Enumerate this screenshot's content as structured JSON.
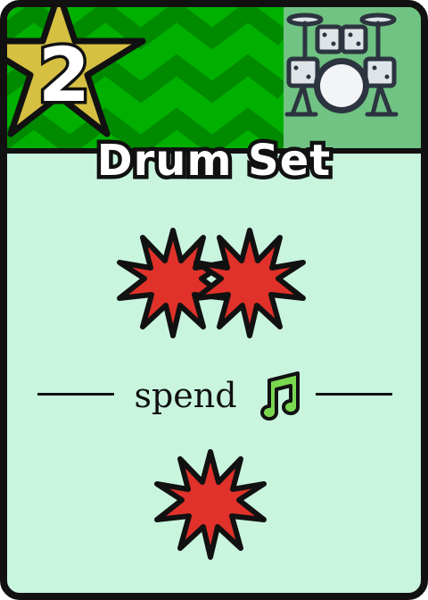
{
  "card": {
    "cost": "2",
    "title": "Drum Set",
    "spend_label": "spend",
    "art_icon": "drum-set-icon",
    "cost_icon": "star-icon",
    "resource_icon": "music-note-icon",
    "top_effect": {
      "icon": "burst-icon",
      "count": 2
    },
    "bottom_effect": {
      "icon": "burst-icon",
      "count": 1
    }
  },
  "colors": {
    "card_background": "#c9f5df",
    "banner_green": "#00b000",
    "banner_zigzag": "#008a00",
    "star_gold": "#d6c042",
    "burst_red": "#e0322a",
    "note_green": "#7ad850",
    "outline": "#111111"
  }
}
